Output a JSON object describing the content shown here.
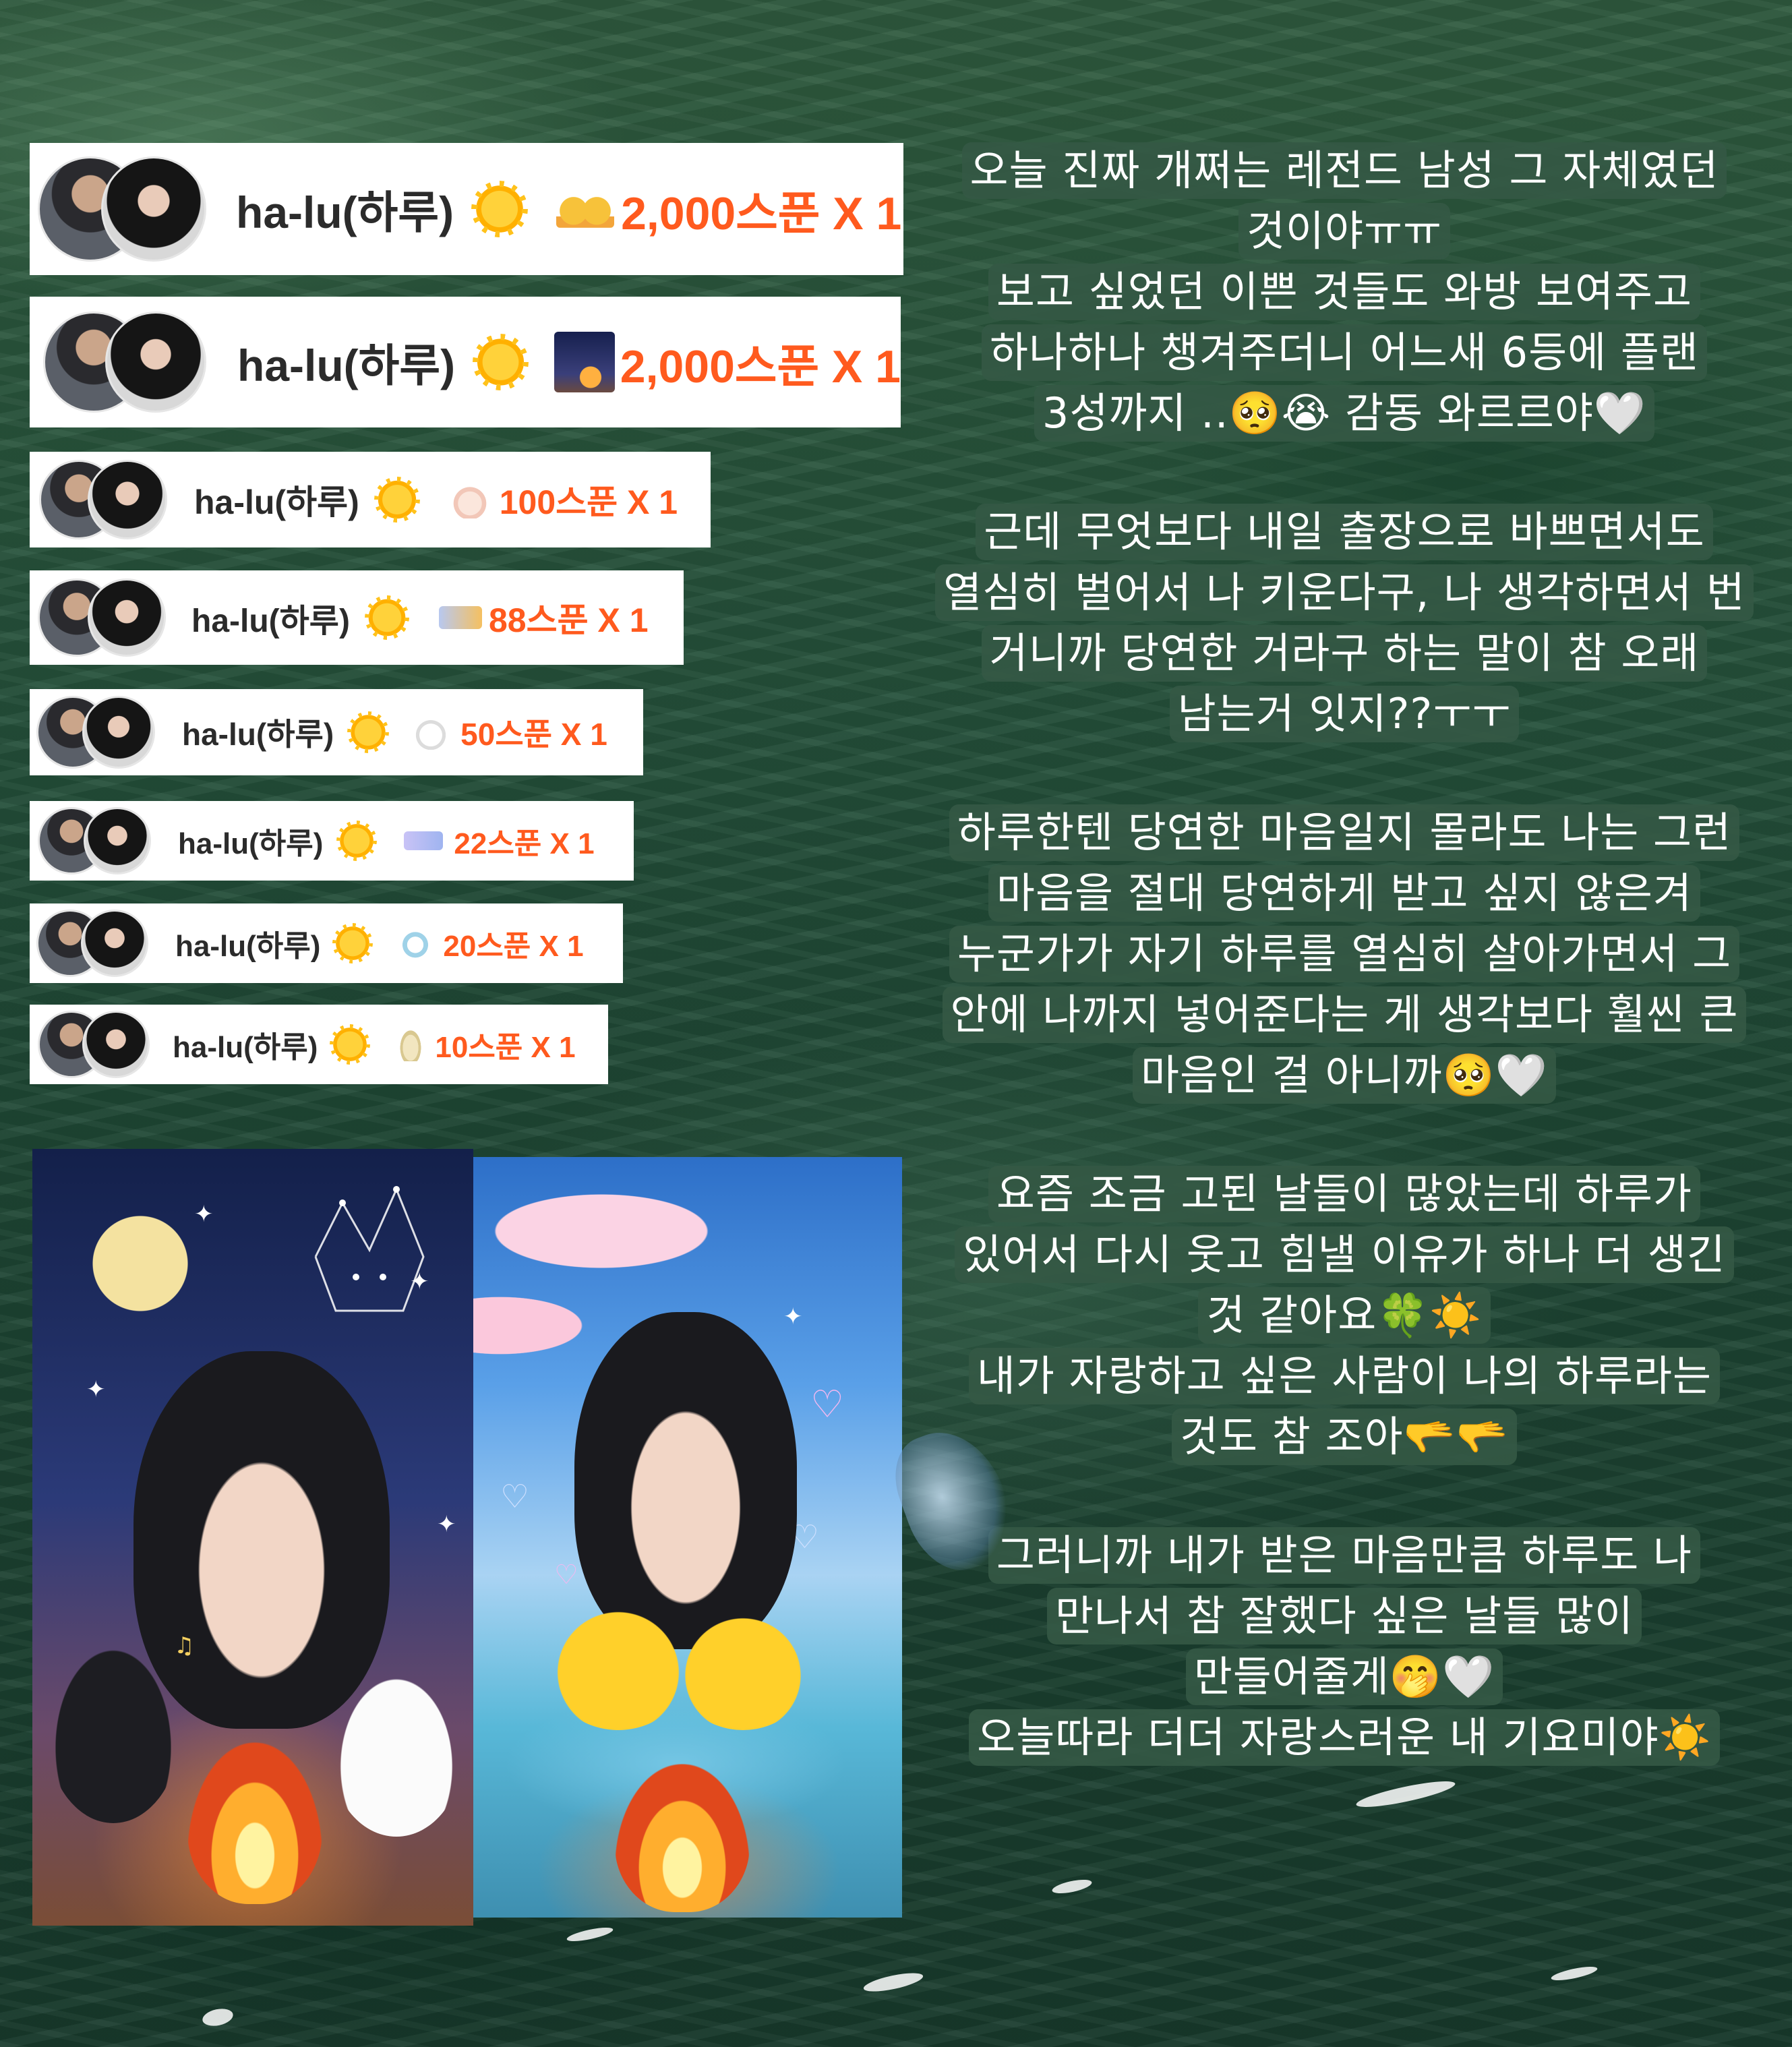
{
  "donations": [
    {
      "nickname": "ha-lu(하루)",
      "sun_icon": "sun-badge-icon",
      "gift_icon": "ducks-gift-icon",
      "gift_color": "#f3a53a",
      "amount": "2,000스푼 X 1"
    },
    {
      "nickname": "ha-lu(하루)",
      "sun_icon": "sun-badge-icon",
      "gift_icon": "night-camp-gift-icon",
      "gift_color": "#2b3a78",
      "amount": "2,000스푼 X 1"
    },
    {
      "nickname": "ha-lu(하루)",
      "sun_icon": "sun-badge-icon",
      "gift_icon": "bunny-gift-icon",
      "gift_color": "#f2c7b8",
      "amount": "100스푼 X 1"
    },
    {
      "nickname": "ha-lu(하루)",
      "sun_icon": "sun-badge-icon",
      "gift_icon": "shooting-star-gift-icon",
      "gift_color": "#f5c060",
      "amount": "88스푼 X 1"
    },
    {
      "nickname": "ha-lu(하루)",
      "sun_icon": "sun-badge-icon",
      "gift_icon": "cat-gift-icon",
      "gift_color": "#e8e8e8",
      "amount": "50스푼 X 1"
    },
    {
      "nickname": "ha-lu(하루)",
      "sun_icon": "sun-badge-icon",
      "gift_icon": "bubble-gift-icon",
      "gift_color": "#b9b3f0",
      "amount": "22스푼 X 1"
    },
    {
      "nickname": "ha-lu(하루)",
      "sun_icon": "sun-badge-icon",
      "gift_icon": "penguin-gift-icon",
      "gift_color": "#9fd2e8",
      "amount": "20스푼 X 1"
    },
    {
      "nickname": "ha-lu(하루)",
      "sun_icon": "sun-badge-icon",
      "gift_icon": "doll-gift-icon",
      "gift_color": "#e8d8a8",
      "amount": "10스푼 X 1"
    }
  ],
  "captions": [
    [
      "오늘 진짜 개쩌는 레전드 남성 그 자체였던",
      "것이야ㅠㅠ",
      "보고 싶었던 이쁜 것들도 와방 보여주고",
      "하나하나 챙겨주더니 어느새 6등에 플랜",
      "3성까지 ..🥺😭 감동 와르르야🤍"
    ],
    [
      "근데 무엇보다 내일 출장으로 바쁘면서도",
      "열심히 벌어서 나 키운다구, 나 생각하면서 번",
      "거니까 당연한 거라구 하는 말이 참 오래",
      "남는거 잇지??ㅜㅜ"
    ],
    [
      "하루한텐 당연한 마음일지 몰라도 나는 그런",
      "마음을 절대 당연하게 받고 싶지 않은겨",
      "누군가가 자기 하루를 열심히 살아가면서 그",
      "안에 나까지 넣어준다는 게 생각보다 훨씬 큰",
      "마음인 걸 아니까🥺🤍"
    ],
    [
      "요즘 조금 고된 날들이 많았는데 하루가",
      "있어서 다시 웃고 힘낼 이유가 하나 더 생긴",
      "것 같아요🍀☀️",
      "내가 자랑하고 싶은 사람이 나의 하루라는",
      "것도 참 조아🫳🫳"
    ],
    [
      "그러니까 내가 받은 마음만큼 하루도 나",
      "만나서 참 잘했다 싶은 날들 많이",
      "만들어줄게🤭🤍",
      "오늘따라 더더 자랑스러운 내 기요미야☀️"
    ]
  ],
  "photos": [
    {
      "name": "night-camp-photo",
      "icon": "crescent-moon-icon"
    },
    {
      "name": "beach-ducks-photo",
      "icon": "rubber-duck-icon"
    }
  ]
}
